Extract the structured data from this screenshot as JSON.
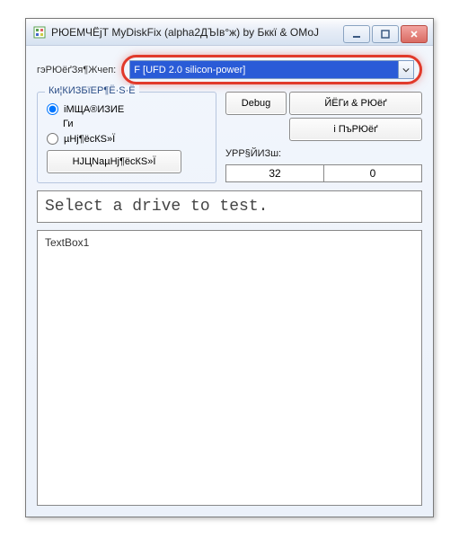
{
  "window": {
    "title": "РЮЕМЧЁјТ MyDiskFix (alpha2ДЪІв°ж) by Бккї & ОМоЈ"
  },
  "drive": {
    "label": "гэРЮёґЗя¶Жчеп:",
    "selected": "F [UFD 2.0 silicon-power]"
  },
  "group": {
    "legend": "Ки¦КИЗБїЕР¶Ё·Ѕ·Ё",
    "radio1": "іМЩА®ИЗИЕ",
    "radio1b": "Ги",
    "radio2": "µНј¶ёсКЅ»Ї",
    "button": "НЈЦNаµНј¶ёсКЅ»Ї"
  },
  "buttons": {
    "debug": "Debug",
    "b1": "ЙЁГи & РЮёґ",
    "b2": "і ПъРЮёґ"
  },
  "stats": {
    "label": "УРР§ЙИЗш:",
    "v1": "32",
    "v2": "0"
  },
  "status": "Select a drive to test.",
  "textbox": "TextBox1"
}
